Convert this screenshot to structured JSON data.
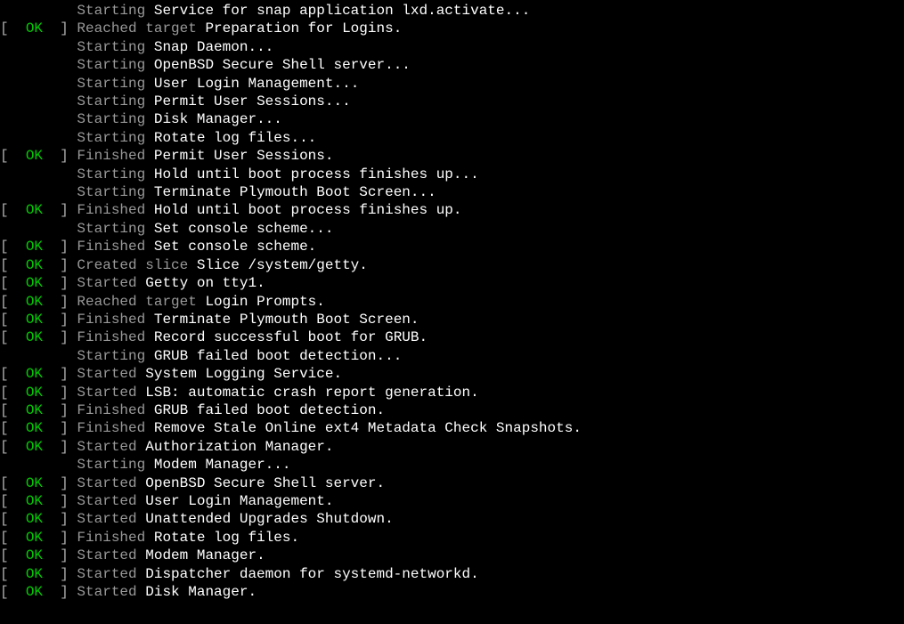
{
  "colors": {
    "ok": "#00cc00",
    "action": "#999999",
    "subject": "#ffffff",
    "bg": "#000000"
  },
  "okLabel": "OK",
  "lines": [
    {
      "status": "",
      "action": "Starting ",
      "subject": "Service for snap application lxd.activate",
      "suffix": "..."
    },
    {
      "status": "ok",
      "action": "Reached target ",
      "subject": "Preparation for Logins",
      "suffix": "."
    },
    {
      "status": "",
      "action": "Starting ",
      "subject": "Snap Daemon",
      "suffix": "..."
    },
    {
      "status": "",
      "action": "Starting ",
      "subject": "OpenBSD Secure Shell server",
      "suffix": "..."
    },
    {
      "status": "",
      "action": "Starting ",
      "subject": "User Login Management",
      "suffix": "..."
    },
    {
      "status": "",
      "action": "Starting ",
      "subject": "Permit User Sessions",
      "suffix": "..."
    },
    {
      "status": "",
      "action": "Starting ",
      "subject": "Disk Manager",
      "suffix": "..."
    },
    {
      "status": "",
      "action": "Starting ",
      "subject": "Rotate log files",
      "suffix": "..."
    },
    {
      "status": "ok",
      "action": "Finished ",
      "subject": "Permit User Sessions",
      "suffix": "."
    },
    {
      "status": "",
      "action": "Starting ",
      "subject": "Hold until boot process finishes up",
      "suffix": "..."
    },
    {
      "status": "",
      "action": "Starting ",
      "subject": "Terminate Plymouth Boot Screen",
      "suffix": "..."
    },
    {
      "status": "ok",
      "action": "Finished ",
      "subject": "Hold until boot process finishes up",
      "suffix": "."
    },
    {
      "status": "",
      "action": "Starting ",
      "subject": "Set console scheme",
      "suffix": "..."
    },
    {
      "status": "ok",
      "action": "Finished ",
      "subject": "Set console scheme",
      "suffix": "."
    },
    {
      "status": "ok",
      "action": "Created slice ",
      "subject": "Slice /system/getty",
      "suffix": "."
    },
    {
      "status": "ok",
      "action": "Started ",
      "subject": "Getty on tty1",
      "suffix": "."
    },
    {
      "status": "ok",
      "action": "Reached target ",
      "subject": "Login Prompts",
      "suffix": "."
    },
    {
      "status": "ok",
      "action": "Finished ",
      "subject": "Terminate Plymouth Boot Screen",
      "suffix": "."
    },
    {
      "status": "ok",
      "action": "Finished ",
      "subject": "Record successful boot for GRUB",
      "suffix": "."
    },
    {
      "status": "",
      "action": "Starting ",
      "subject": "GRUB failed boot detection",
      "suffix": "..."
    },
    {
      "status": "ok",
      "action": "Started ",
      "subject": "System Logging Service",
      "suffix": "."
    },
    {
      "status": "ok",
      "action": "Started ",
      "subject": "LSB: automatic crash report generation",
      "suffix": "."
    },
    {
      "status": "ok",
      "action": "Finished ",
      "subject": "GRUB failed boot detection",
      "suffix": "."
    },
    {
      "status": "ok",
      "action": "Finished ",
      "subject": "Remove Stale Online ext4 Metadata Check Snapshots",
      "suffix": "."
    },
    {
      "status": "ok",
      "action": "Started ",
      "subject": "Authorization Manager",
      "suffix": "."
    },
    {
      "status": "",
      "action": "Starting ",
      "subject": "Modem Manager",
      "suffix": "..."
    },
    {
      "status": "ok",
      "action": "Started ",
      "subject": "OpenBSD Secure Shell server",
      "suffix": "."
    },
    {
      "status": "ok",
      "action": "Started ",
      "subject": "User Login Management",
      "suffix": "."
    },
    {
      "status": "ok",
      "action": "Started ",
      "subject": "Unattended Upgrades Shutdown",
      "suffix": "."
    },
    {
      "status": "ok",
      "action": "Finished ",
      "subject": "Rotate log files",
      "suffix": "."
    },
    {
      "status": "ok",
      "action": "Started ",
      "subject": "Modem Manager",
      "suffix": "."
    },
    {
      "status": "ok",
      "action": "Started ",
      "subject": "Dispatcher daemon for systemd-networkd",
      "suffix": "."
    },
    {
      "status": "ok",
      "action": "Started ",
      "subject": "Disk Manager",
      "suffix": "."
    }
  ]
}
